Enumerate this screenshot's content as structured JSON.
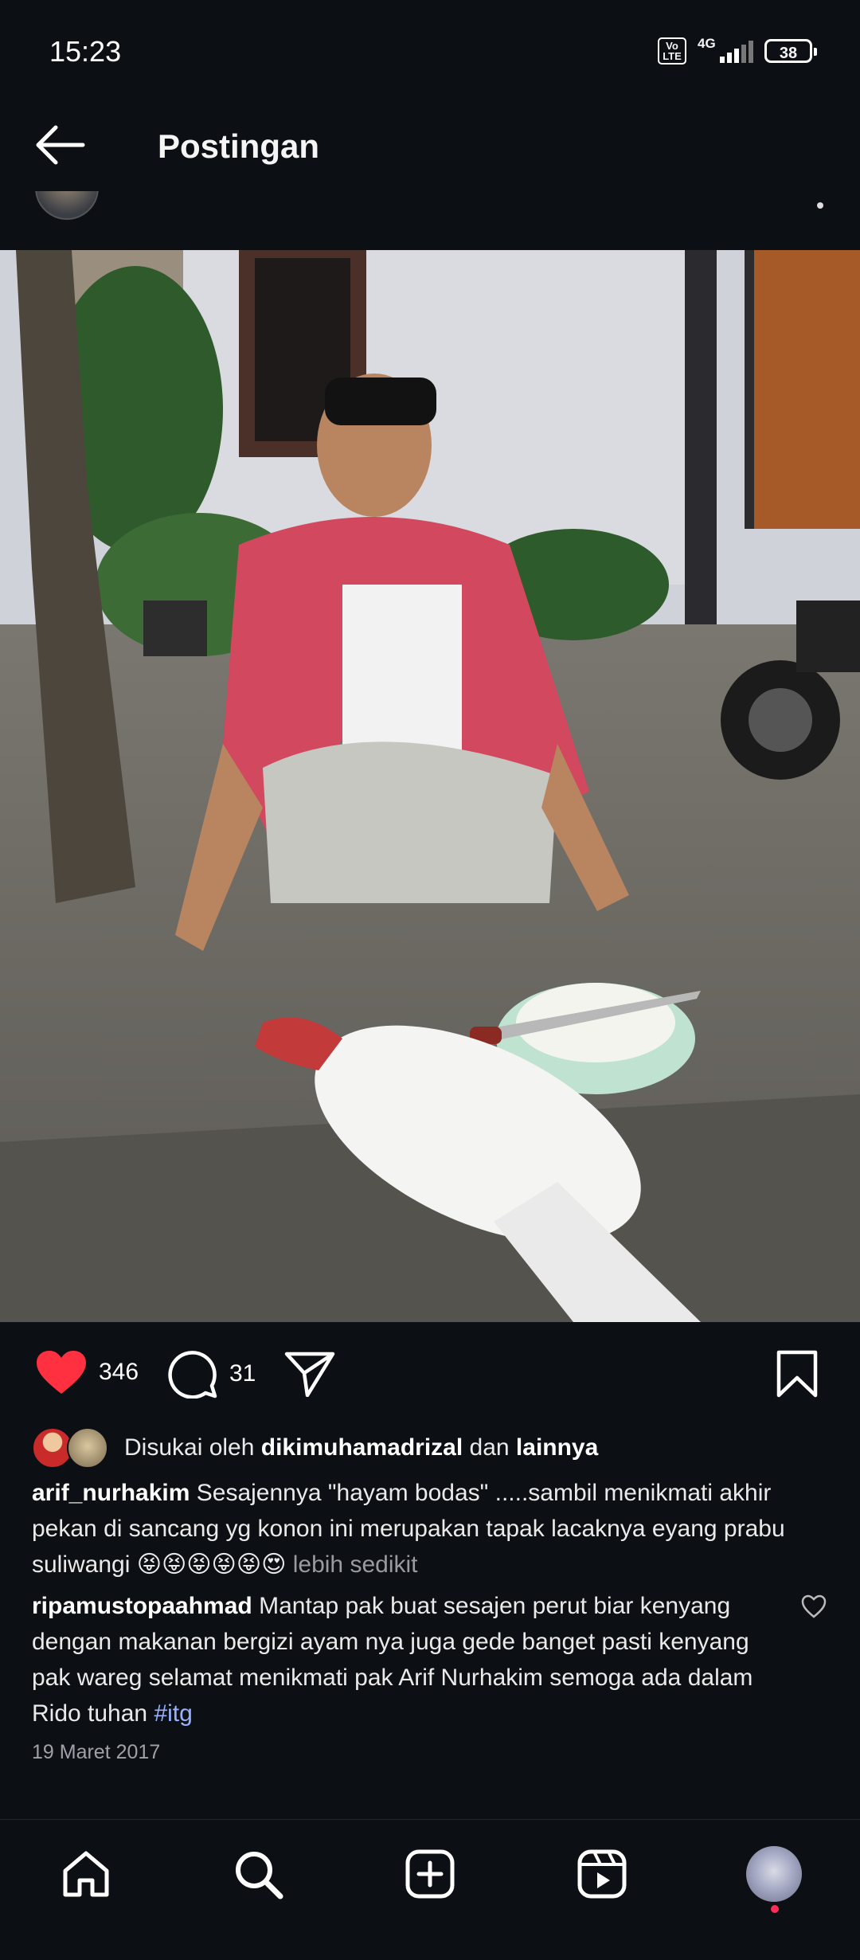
{
  "status_bar": {
    "time": "15:23",
    "volte": "Vo LTE",
    "network": "4G",
    "battery": "38"
  },
  "header": {
    "title": "Postingan"
  },
  "post": {
    "image_icon": "photo",
    "like_count": "346",
    "comment_count": "31",
    "liked_by": {
      "prefix": "Disukai oleh",
      "user": "dikimuhamadrizal",
      "joiner": "dan",
      "others": "lainnya"
    },
    "caption": {
      "username": "arif_nurhakim",
      "text": "Sesajennya \"hayam bodas\" .....sambil menikmati akhir pekan di sancang yg konon ini merupakan tapak lacaknya eyang prabu suliwangi 😝😝😝😝😝😍",
      "more_label": "lebih sedikit"
    },
    "comment": {
      "username": "ripamustopaahmad",
      "text": "Mantap pak buat sesajen perut biar kenyang dengan makanan bergizi ayam nya juga gede banget pasti kenyang pak wareg selamat menikmati pak Arif Nurhakim semoga ada dalam Rido tuhan",
      "hashtag": "#itg"
    },
    "date": "19 Maret 2017"
  },
  "colors": {
    "background": "#0c0f14",
    "like_red": "#ff3040",
    "hashtag": "#9ab1ff",
    "notification_dot": "#ff2d55"
  },
  "bottom_nav": [
    "home-icon",
    "search-icon",
    "create-icon",
    "reels-icon",
    "profile-avatar"
  ]
}
